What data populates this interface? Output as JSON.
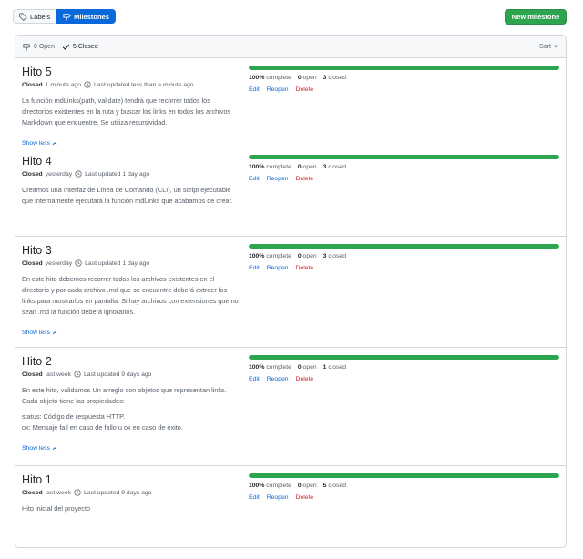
{
  "toolbar": {
    "labels_button": "Labels",
    "milestones_button": "Milestones",
    "new_milestone_button": "New milestone"
  },
  "filters": {
    "open": "0 Open",
    "closed": "5 Closed",
    "sort": "Sort"
  },
  "milestones": [
    {
      "title": "Hito 5",
      "state": "Closed",
      "closed_when": "1 minute ago",
      "updated": "Last updated less than a minute ago",
      "description": [
        "La función mdLinks(path, validate) tendrá que recorrer todos los directorios existentes en la ruta y buscar los links en todos los archivos Markdown que encuentre. Se utiliza recursividad."
      ],
      "show_less": "Show less",
      "progress": 1.0,
      "complete": "100%",
      "complete_label": "complete",
      "open": "0",
      "open_label": "open",
      "closed": "3",
      "closed_label": "closed",
      "edit": "Edit",
      "reopen": "Reopen",
      "delete": "Delete"
    },
    {
      "title": "Hito 4",
      "state": "Closed",
      "closed_when": "yesterday",
      "updated": "Last updated 1 day ago",
      "description": [
        "Creamos una Interfaz de Línea de Comando (CLI), un script ejecutable que internamente ejecutará la función mdLinks que acabamos de crear."
      ],
      "show_less": "",
      "progress": 1.0,
      "complete": "100%",
      "complete_label": "complete",
      "open": "0",
      "open_label": "open",
      "closed": "3",
      "closed_label": "closed",
      "edit": "Edit",
      "reopen": "Reopen",
      "delete": "Delete"
    },
    {
      "title": "Hito 3",
      "state": "Closed",
      "closed_when": "yesterday",
      "updated": "Last updated 1 day ago",
      "description": [
        "En este hito debemos recorrer todos los archivos existentes en el directorio y por cada archivo .md que se encuentre deberá extraer los links para mostrarlos en pantalla. Si hay archivos con extensiones que no sean .md la función deberá ignorarlos."
      ],
      "show_less": "Show less",
      "progress": 1.0,
      "complete": "100%",
      "complete_label": "complete",
      "open": "0",
      "open_label": "open",
      "closed": "3",
      "closed_label": "closed",
      "edit": "Edit",
      "reopen": "Reopen",
      "delete": "Delete"
    },
    {
      "title": "Hito 2",
      "state": "Closed",
      "closed_when": "last week",
      "updated": "Last updated 9 days ago",
      "description": [
        "En este hito, validamos Un arreglo con objetos que representan links. Cada objeto tiene las propiedades:",
        "status: Código de respuesta HTTP.\nok: Mensaje fail en caso de fallo u ok en caso de éxito."
      ],
      "show_less": "Show less",
      "progress": 1.0,
      "complete": "100%",
      "complete_label": "complete",
      "open": "0",
      "open_label": "open",
      "closed": "1",
      "closed_label": "closed",
      "edit": "Edit",
      "reopen": "Reopen",
      "delete": "Delete"
    },
    {
      "title": "Hito 1",
      "state": "Closed",
      "closed_when": "last week",
      "updated": "Last updated 9 days ago",
      "description": [
        "Hito inicial del proyecto"
      ],
      "show_less": "",
      "progress": 1.0,
      "complete": "100%",
      "complete_label": "complete",
      "open": "0",
      "open_label": "open",
      "closed": "5",
      "closed_label": "closed",
      "edit": "Edit",
      "reopen": "Reopen",
      "delete": "Delete"
    }
  ],
  "colors": {
    "primary": "#0969da",
    "success": "#2da44e",
    "danger": "#cf222e"
  }
}
